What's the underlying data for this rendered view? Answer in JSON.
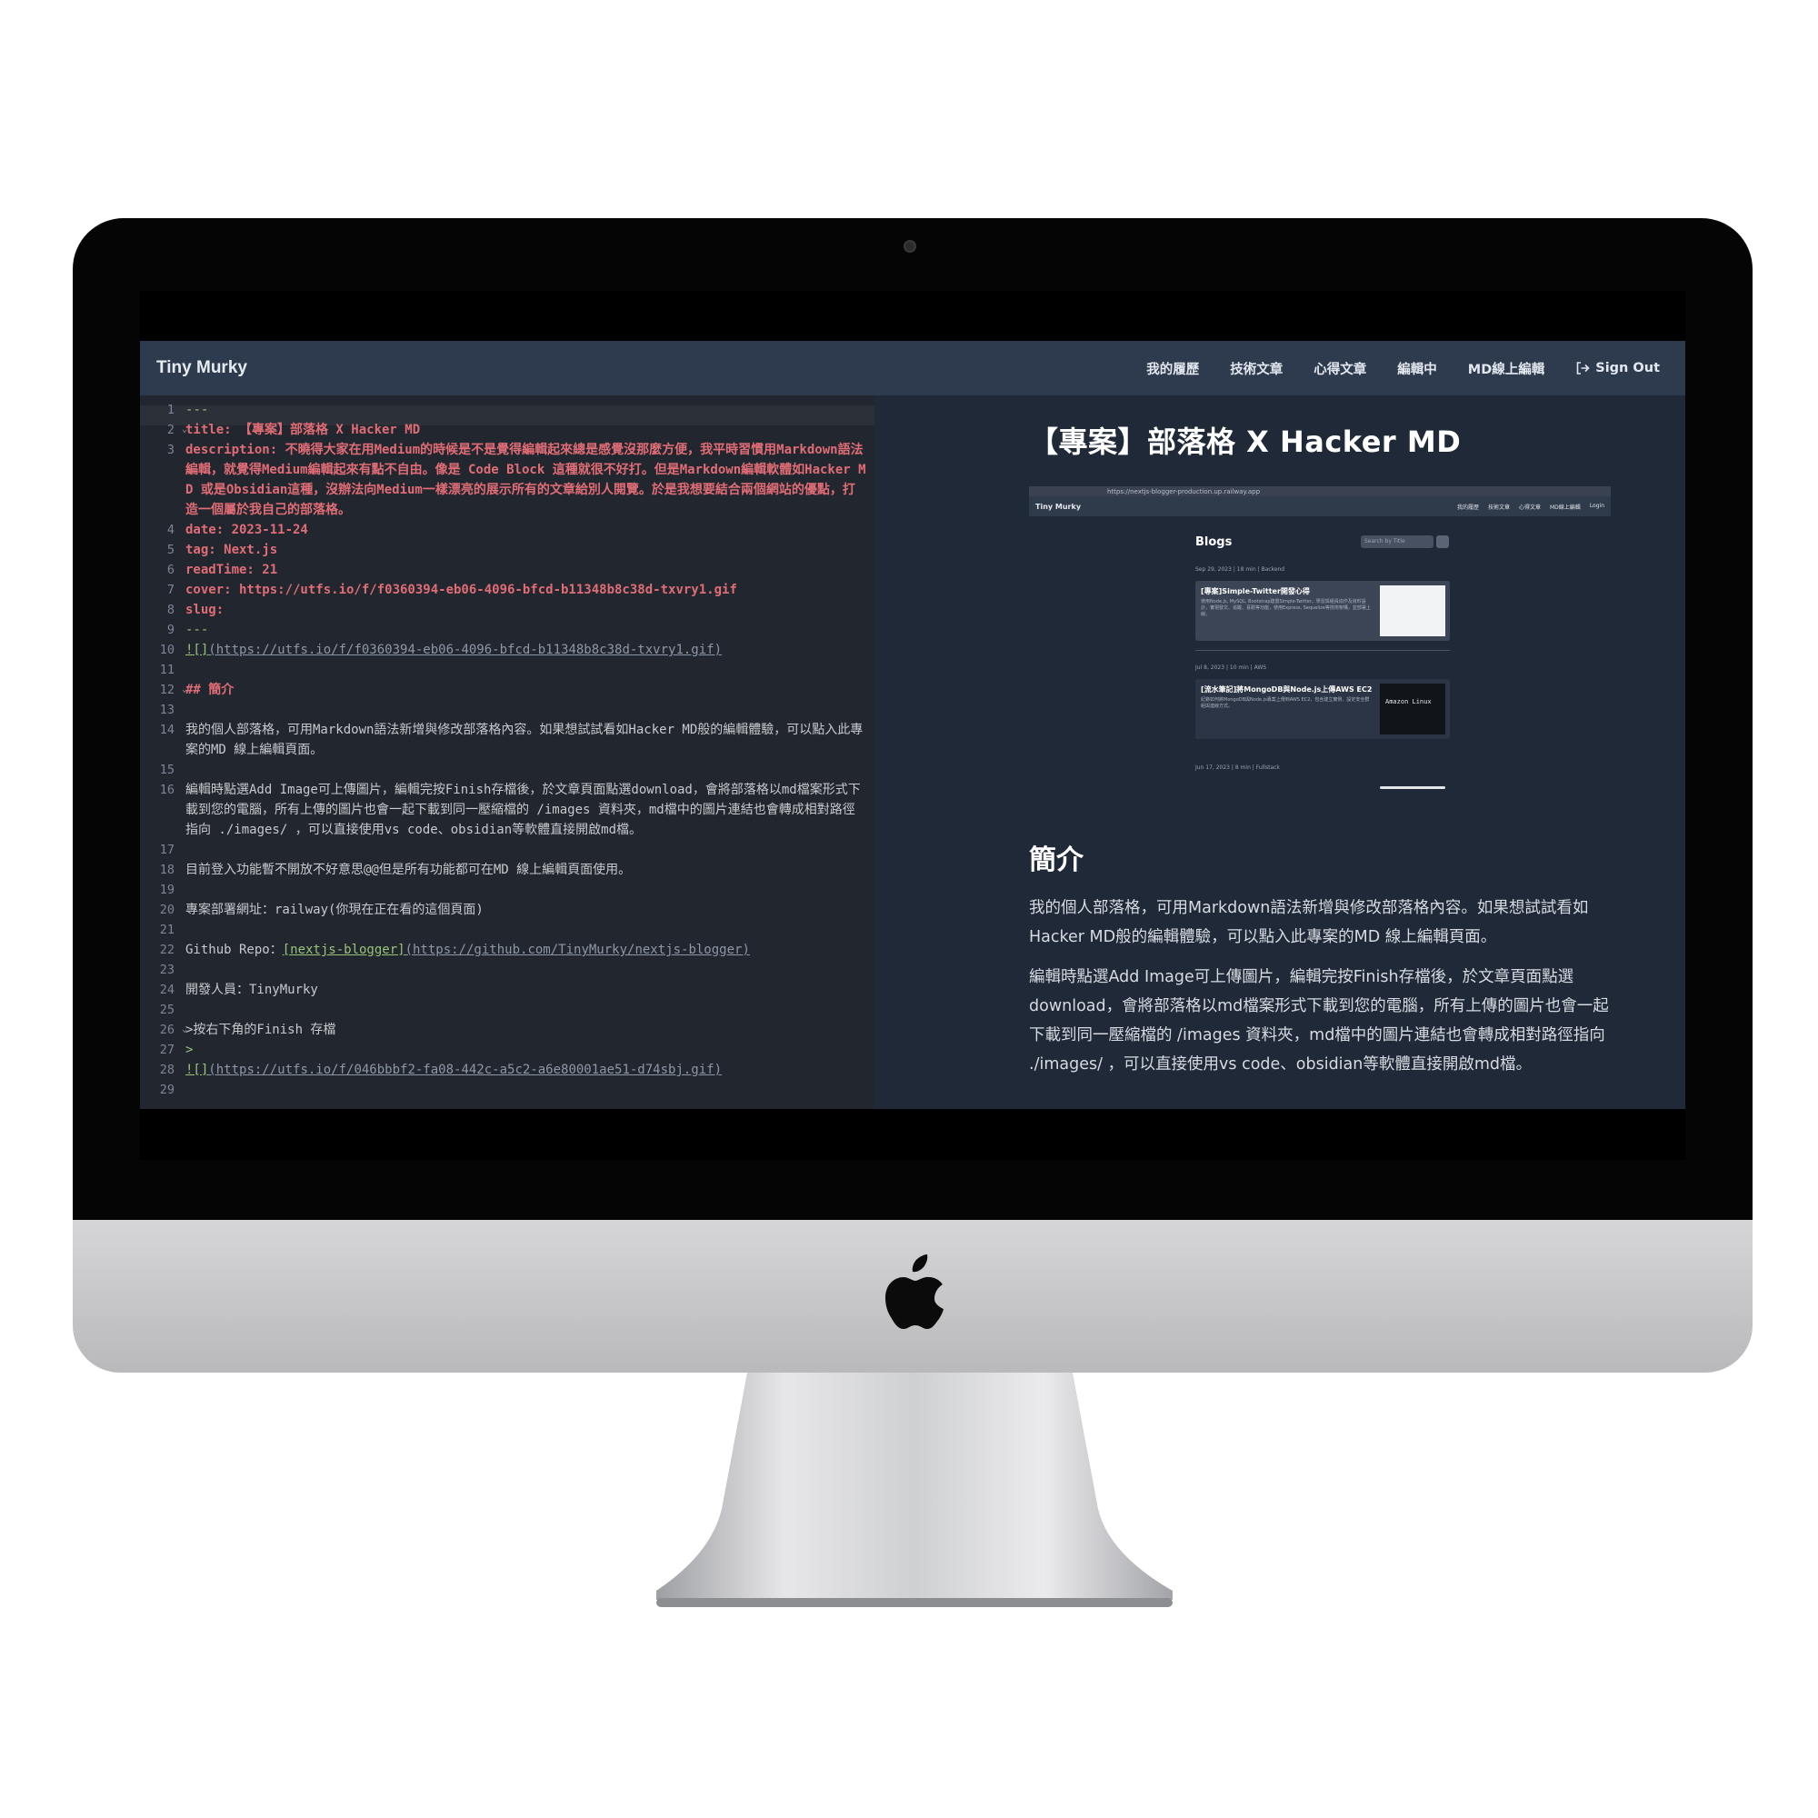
{
  "app": {
    "brand": "Tiny Murky",
    "nav": [
      {
        "label": "我的履歷"
      },
      {
        "label": "技術文章"
      },
      {
        "label": "心得文章"
      },
      {
        "label": "編輯中"
      },
      {
        "label": "MD線上編輯"
      },
      {
        "label": "Sign Out",
        "icon": "sign-out-icon"
      }
    ]
  },
  "editor": {
    "lines": [
      {
        "n": "1",
        "text": "---"
      },
      {
        "n": "2",
        "text": "title: 【專案】部落格 X Hacker MD"
      },
      {
        "n": "3",
        "text": "description: 不曉得大家在用Medium的時候是不是覺得編輯起來總是感覺沒那麼方便，我平時習慣用Markdown語法編輯，就覺得Medium編輯起來有點不自由。像是 Code Block 這種就很不好打。但是Markdown編輯軟體如Hacker MD 或是Obsidian這種，沒辦法向Medium一樣漂亮的展示所有的文章給別人閱覽。於是我想要結合兩個網站的優點，打造一個屬於我自己的部落格。"
      },
      {
        "n": "4",
        "text": "date: 2023-11-24"
      },
      {
        "n": "5",
        "text": "tag: Next.js"
      },
      {
        "n": "6",
        "text": "readTime: 21"
      },
      {
        "n": "7",
        "text": "cover: https://utfs.io/f/f0360394-eb06-4096-bfcd-b11348b8c38d-txvry1.gif"
      },
      {
        "n": "8",
        "text": "slug:"
      },
      {
        "n": "9",
        "text": "---"
      },
      {
        "n": "10",
        "text_a": "![]",
        "text_b": "(https://utfs.io/f/f0360394-eb06-4096-bfcd-b11348b8c38d-txvry1.gif)"
      },
      {
        "n": "11",
        "text": ""
      },
      {
        "n": "12",
        "text": "## 簡介"
      },
      {
        "n": "13",
        "text": ""
      },
      {
        "n": "14",
        "text": "我的個人部落格，可用Markdown語法新增與修改部落格內容。如果想試試看如Hacker MD般的編輯體驗，可以點入此專案的MD 線上編輯頁面。"
      },
      {
        "n": "15",
        "text": ""
      },
      {
        "n": "16",
        "text": "編輯時點選Add Image可上傳圖片，編輯完按Finish存檔後，於文章頁面點選download，會將部落格以md檔案形式下載到您的電腦，所有上傳的圖片也會一起下載到同一壓縮檔的 /images 資料夾，md檔中的圖片連結也會轉成相對路徑指向 ./images/ ，可以直接使用vs code、obsidian等軟體直接開啟md檔。"
      },
      {
        "n": "17",
        "text": ""
      },
      {
        "n": "18",
        "text": "目前登入功能暫不開放不好意思@@但是所有功能都可在MD 線上編輯頁面使用。"
      },
      {
        "n": "19",
        "text": ""
      },
      {
        "n": "20",
        "text": "專案部署網址：railway(你現在正在看的這個頁面)"
      },
      {
        "n": "21",
        "text": ""
      },
      {
        "n": "22",
        "text_a": "Github Repo：",
        "text_b": "[nextjs-blogger]",
        "text_c": "(https://github.com/TinyMurky/nextjs-blogger)"
      },
      {
        "n": "23",
        "text": ""
      },
      {
        "n": "24",
        "text": "開發人員：TinyMurky"
      },
      {
        "n": "25",
        "text": ""
      },
      {
        "n": "26",
        "text": ">按右下角的Finish 存檔"
      },
      {
        "n": "27",
        "text": ">"
      },
      {
        "n": "28",
        "text_a": "![]",
        "text_b": "(https://utfs.io/f/046bbbf2-fa08-442c-a5c2-a6e80001ae51-d74sbj.gif)"
      },
      {
        "n": "29",
        "text": ""
      }
    ]
  },
  "preview": {
    "title": "【專案】部落格 X Hacker MD",
    "section_heading": "簡介",
    "paragraph_1": "我的個人部落格，可用Markdown語法新增與修改部落格內容。如果想試試看如Hacker MD般的編輯體驗，可以點入此專案的MD 線上編輯頁面。",
    "paragraph_2": "編輯時點選Add Image可上傳圖片，編輯完按Finish存檔後，於文章頁面點選download，會將部落格以md檔案形式下載到您的電腦，所有上傳的圖片也會一起下載到同一壓縮檔的 /images 資料夾，md檔中的圖片連結也會轉成相對路徑指向 ./images/ ，可以直接使用vs code、obsidian等軟體直接開啟md檔。",
    "screenshot": {
      "url": "https://nextjs-blogger-production.up.railway.app",
      "brand": "Tiny Murky",
      "nav": [
        "我的履歷",
        "技術文章",
        "心得文章",
        "MD線上編輯",
        "Login"
      ],
      "heading": "Blogs",
      "search_placeholder": "Search by Title",
      "posts": [
        {
          "meta": "Sep 29, 2023  |  18 min  |  Backend",
          "title": "[專案]Simple-Twitter開發心得",
          "excerpt": "使用Node.js, MySQL, Bootstrap建置Simple-Twitter，學習與組員協作及資料設計，實現發文、追蹤、喜歡等功能，使用Express, Sequelize等技術架構，並部署上線。"
        },
        {
          "meta": "Jul 8, 2023  |  10 min  |  AWS",
          "title": "[流水筆記]將MongoDB與Node.js上傳AWS EC2",
          "excerpt": "紀錄如何將MongoDB與Node.js專案上傳到AWS EC2，包含建立實例、設定安全群組與連線方式。",
          "thumb": "Amazon Linux"
        },
        {
          "meta": "Jun 17, 2023  |  8 min  |  Fullstack"
        }
      ]
    }
  }
}
